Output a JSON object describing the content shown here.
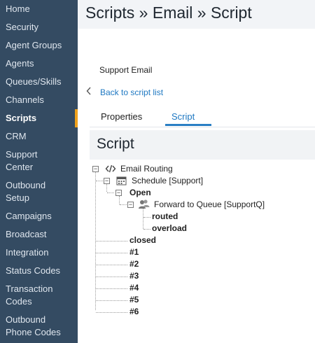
{
  "sidebar": {
    "items": [
      {
        "label": "Home"
      },
      {
        "label": "Security"
      },
      {
        "label": "Agent Groups"
      },
      {
        "label": "Agents"
      },
      {
        "label": "Queues/Skills"
      },
      {
        "label": "Channels"
      },
      {
        "label": "Scripts",
        "active": true
      },
      {
        "label": "CRM"
      },
      {
        "label": "Support",
        "label2": "Center"
      },
      {
        "label": "Outbound",
        "label2": "Setup"
      },
      {
        "label": "Campaigns"
      },
      {
        "label": "Broadcast"
      },
      {
        "label": "Integration"
      },
      {
        "label": "Status Codes"
      },
      {
        "label": "Transaction",
        "label2": "Codes"
      },
      {
        "label": "Outbound",
        "label2": "Phone Codes"
      }
    ]
  },
  "header": {
    "title": "Scripts » Email » Script"
  },
  "script": {
    "name": "Support Email"
  },
  "back_link": {
    "label": "Back to script list"
  },
  "tabs": [
    {
      "label": "Properties"
    },
    {
      "label": "Script",
      "active": true
    }
  ],
  "section": {
    "title": "Script"
  },
  "tree": {
    "email_routing": "Email Routing",
    "schedule": "Schedule [Support]",
    "open": "Open",
    "forward": "Forward to Queue [SupportQ]",
    "routed": "routed",
    "overload": "overload",
    "closed": "closed",
    "n1": "#1",
    "n2": "#2",
    "n3": "#3",
    "n4": "#4",
    "n5": "#5",
    "n6": "#6",
    "collapse_symbol": "−"
  }
}
